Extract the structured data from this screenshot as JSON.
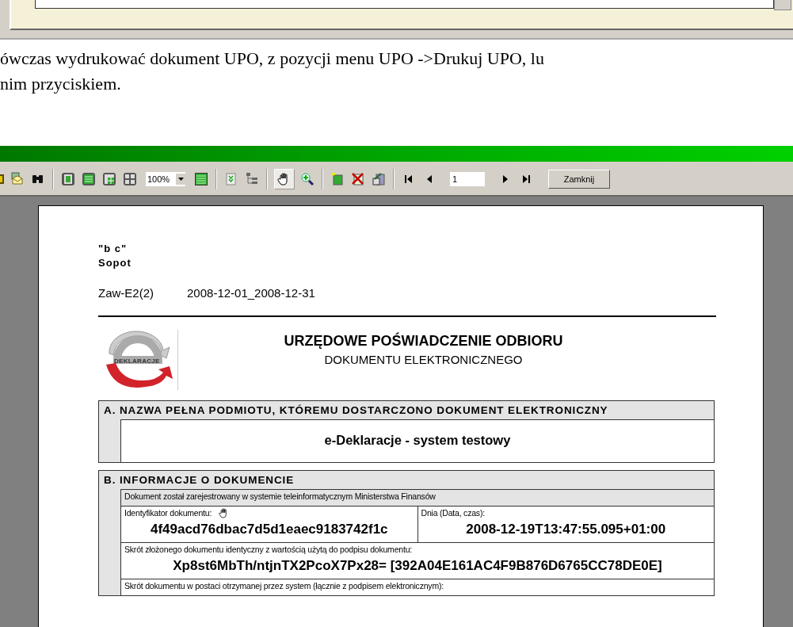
{
  "paragraph": {
    "lines": [
      "ówczas wydrukować dokument UPO, z pozycji menu UPO ->Drukuj UPO, lu",
      "nim przyciskiem."
    ]
  },
  "toolbar": {
    "tools": [
      {
        "kind": "print",
        "pressed": false
      },
      {
        "kind": "mail",
        "pressed": false
      },
      {
        "kind": "find",
        "pressed": false
      },
      {
        "kind": "separator"
      },
      {
        "kind": "page-single",
        "pressed": false
      },
      {
        "kind": "page-width",
        "pressed": false
      },
      {
        "kind": "page-grid",
        "pressed": false
      },
      {
        "kind": "page-four",
        "pressed": false
      },
      {
        "kind": "zoom-select",
        "value": "100%"
      },
      {
        "kind": "page-fit",
        "pressed": false
      },
      {
        "kind": "separator"
      },
      {
        "kind": "expand",
        "pressed": false
      },
      {
        "kind": "tree",
        "pressed": false
      },
      {
        "kind": "separator"
      },
      {
        "kind": "hand",
        "pressed": true
      },
      {
        "kind": "zoom-in",
        "pressed": false
      },
      {
        "kind": "separator"
      },
      {
        "kind": "new",
        "pressed": false
      },
      {
        "kind": "delete",
        "pressed": false
      },
      {
        "kind": "export",
        "pressed": false
      },
      {
        "kind": "separator"
      },
      {
        "kind": "first",
        "pressed": false
      },
      {
        "kind": "prev",
        "pressed": false
      },
      {
        "kind": "page-field",
        "value": "1"
      },
      {
        "kind": "next",
        "pressed": false
      },
      {
        "kind": "last",
        "pressed": false
      },
      {
        "kind": "close",
        "label": "Zamknij"
      }
    ]
  },
  "document": {
    "company": "\"b c\"",
    "city": "Sopot",
    "form": "Zaw-E2(2)",
    "period": "2008-12-01_2008-12-31",
    "logo_text": "DEKLARACJE",
    "title": "URZĘDOWE POŚWIADCZENIE ODBIORU",
    "subtitle": "DOKUMENTU ELEKTRONICZNEGO",
    "sections": [
      {
        "heading": "A. NAZWA PEŁNA PODMIOTU, KTÓREMU DOSTARCZONO DOKUMENT ELEKTRONICZNY",
        "rows": [
          {
            "shaded": false,
            "cells": [
              {
                "value": "e-Deklaracje - system testowy"
              }
            ]
          }
        ]
      },
      {
        "heading": "B. INFORMACJE O DOKUMENCIE",
        "rows": [
          {
            "shaded": true,
            "cells": [
              {
                "label": "Dokument został zarejestrowany w systemie teleinformatycznym Ministerstwa Finansów"
              }
            ]
          },
          {
            "shaded": false,
            "cells": [
              {
                "label": "Identyfikator dokumentu:",
                "value": "4f49acd76dbac7d5d1eaec9183742f1c"
              },
              {
                "label": "Dnia (Data, czas):",
                "value": "2008-12-19T13:47:55.095+01:00"
              }
            ]
          },
          {
            "shaded": false,
            "cells": [
              {
                "label": "Skrót złożonego dokumentu identyczny z wartością użytą do podpisu dokumentu:",
                "value": "Xp8st6MbTh/ntjnTX2PcoX7Px28= [392A04E161AC4F9B876D6765CC78DE0E]"
              }
            ]
          },
          {
            "shaded": false,
            "cells": [
              {
                "label": "Skrót dokumentu w postaci otrzymanej przez system (łącznie z podpisem elektronicznym):"
              }
            ]
          }
        ]
      }
    ]
  }
}
